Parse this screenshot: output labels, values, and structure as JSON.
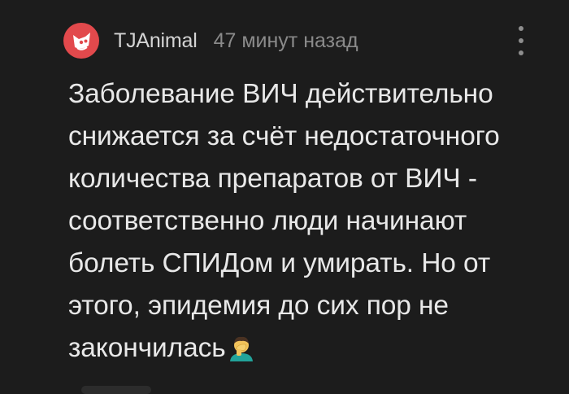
{
  "comment": {
    "author": "TJAnimal",
    "time_ago": "47 минут назад",
    "lines": [
      "Заболевание ВИЧ действительно",
      "снижается за счёт недостаточного",
      "количества препаратов от ВИЧ -",
      "соответственно люди начинают",
      "болеть СПИДом и умирать. Но от",
      "этого, эпидемия до сих пор не",
      "закончилась"
    ],
    "emoji": "facepalm-man-icon"
  },
  "icons": {
    "avatar": "cat-avatar-icon",
    "menu": "more-vertical-icon"
  },
  "colors": {
    "background": "#1c1c1c",
    "avatar": "#e2494c",
    "text": "#e8e8e8",
    "muted": "#8a8a8a"
  }
}
